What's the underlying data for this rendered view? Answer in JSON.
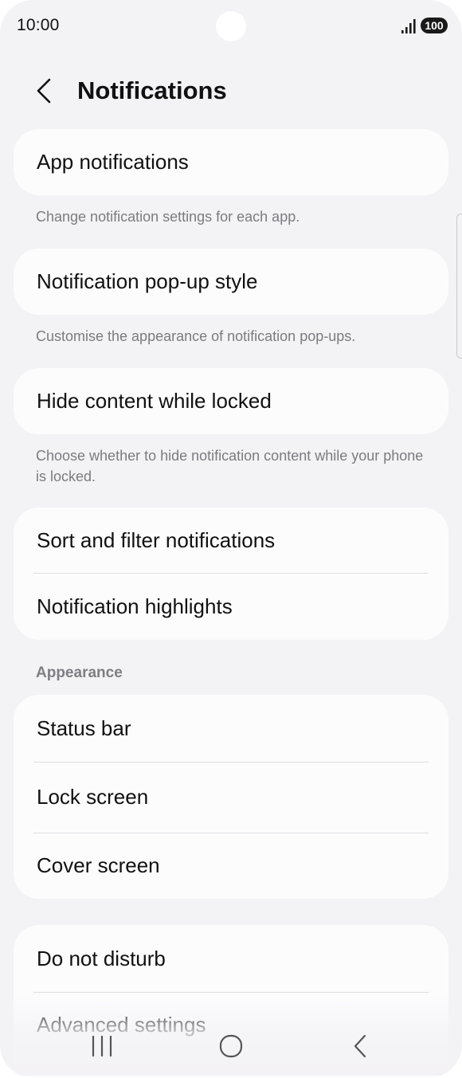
{
  "status_bar": {
    "time": "10:00",
    "battery": "100",
    "signal_icon": "cellular-signal-icon"
  },
  "header": {
    "back_icon": "chevron-left-icon",
    "title": "Notifications"
  },
  "items": {
    "app_notifications": {
      "label": "App notifications",
      "description": "Change notification settings for each app."
    },
    "popup_style": {
      "label": "Notification pop-up style",
      "description": "Customise the appearance of notification pop-ups."
    },
    "hide_content": {
      "label": "Hide content while locked",
      "description": "Choose whether to hide notification content while your phone is locked."
    },
    "sort_filter": {
      "label": "Sort and filter notifications"
    },
    "highlights": {
      "label": "Notification highlights"
    }
  },
  "appearance": {
    "section_title": "Appearance",
    "items": [
      {
        "label": "Status bar"
      },
      {
        "label": "Lock screen"
      },
      {
        "label": "Cover screen"
      }
    ]
  },
  "bottom_group": {
    "items": [
      {
        "label": "Do not disturb"
      },
      {
        "label": "Advanced settings"
      }
    ]
  },
  "nav_bar": {
    "recents_icon": "recents-icon",
    "home_icon": "home-icon",
    "back_icon": "back-icon"
  },
  "colors": {
    "background": "#f3f2f5",
    "card": "#fcfcfd",
    "text_primary": "#111111",
    "text_secondary": "#7c7b80"
  }
}
